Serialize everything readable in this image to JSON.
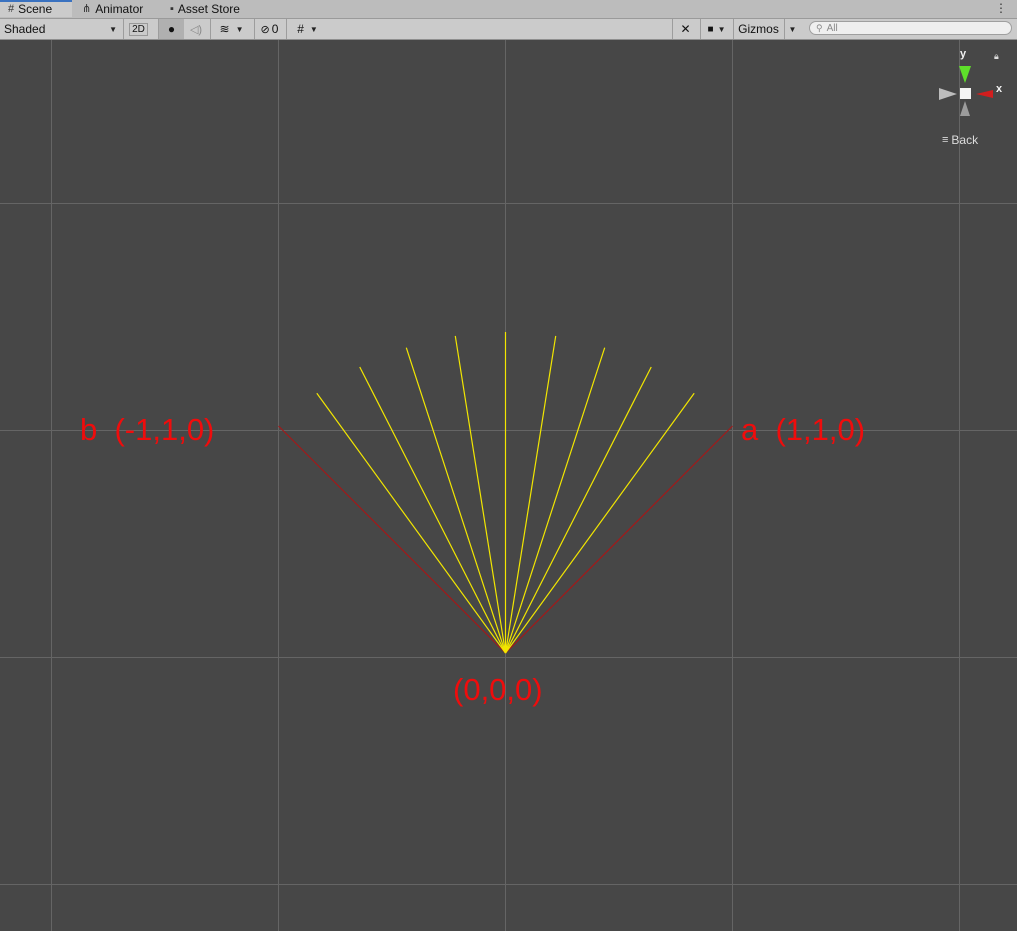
{
  "tabs": [
    {
      "label": "Scene",
      "icon": "grid-icon"
    },
    {
      "label": "Animator",
      "icon": "animator-icon"
    },
    {
      "label": "Asset Store",
      "icon": "bag-icon"
    }
  ],
  "toolbar": {
    "draw_mode": "Shaded",
    "mode_2d": "2D",
    "hidden_count": "0",
    "gizmos": "Gizmos",
    "search_placeholder": "All"
  },
  "scene": {
    "label_b": "b  (-1,1,0)",
    "label_a": "a  (1,1,0)",
    "label_origin": "(0,0,0)",
    "line_color": "#a11a1a",
    "ray_color": "#f2e600",
    "label_color": "#f00c0c"
  },
  "gizmo": {
    "y_label": "y",
    "x_label": "x",
    "view_label": "Back"
  }
}
